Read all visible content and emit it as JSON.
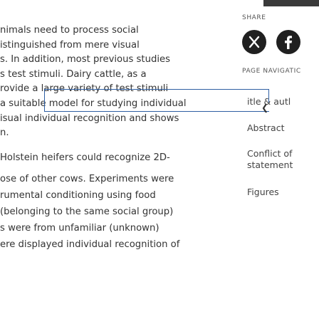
{
  "article": {
    "lines": [
      "nimals need to process social",
      "istinguished from mere visual",
      "s. In addition, most previous studies",
      "s test stimuli. Dairy cattle, as a",
      "rovide a large variety of test stimuli",
      "a suitable model for studying individual",
      "isual individual recognition and shows",
      "n.",
      "Holstein heifers could recognize 2D-",
      "ose of other cows. Experiments were",
      "rumental conditioning using food",
      "(belonging to the same social group)",
      "s were from unfamiliar (unknown)",
      "ere displayed individual recognition of"
    ]
  },
  "sidebar": {
    "share_label": "SHARE",
    "page_nav_label": "PAGE NAVIGATIC",
    "nav_items": [
      "itle & autl",
      "Abstract",
      "Conflict of statement",
      "Figures"
    ]
  },
  "icons": {
    "share1": "x-twitter-icon",
    "share2": "facebook-icon"
  },
  "colors": {
    "selection_border": "#2e5fa3",
    "icon_bg": "#202020"
  }
}
